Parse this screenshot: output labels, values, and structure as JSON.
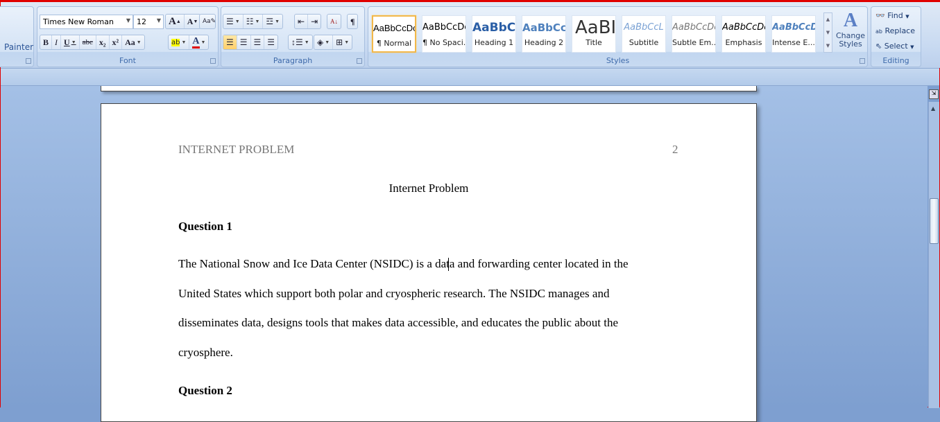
{
  "ribbon": {
    "clipboard": {
      "painter_label": "Painter"
    },
    "font": {
      "label": "Font",
      "font_name": "Times New Roman",
      "font_size": "12",
      "buttons": [
        "B",
        "I",
        "U",
        "abc",
        "x₂",
        "x²",
        "Aa"
      ],
      "font_color": "#e00000",
      "highlight_color": "#ffff00"
    },
    "paragraph": {
      "label": "Paragraph",
      "active_alignment": "align-left"
    },
    "styles": {
      "label": "Styles",
      "items": [
        {
          "preview": "AaBbCcDc",
          "name": "¶ Normal",
          "selected": true
        },
        {
          "preview": "AaBbCcDc",
          "name": "¶ No Spaci..."
        },
        {
          "preview": "AaBbC(",
          "name": "Heading 1"
        },
        {
          "preview": "AaBbCc",
          "name": "Heading 2"
        },
        {
          "preview": "AaBI",
          "name": "Title"
        },
        {
          "preview": "AaBbCcL",
          "name": "Subtitle"
        },
        {
          "preview": "AaBbCcDc",
          "name": "Subtle Em..."
        },
        {
          "preview": "AaBbCcDc",
          "name": "Emphasis"
        },
        {
          "preview": "AaBbCcDc",
          "name": "Intense E..."
        }
      ],
      "change_styles": "Change Styles"
    },
    "editing": {
      "label": "Editing",
      "find": "Find",
      "replace": "Replace",
      "select": "Select"
    }
  },
  "document": {
    "header_left": "INTERNET PROBLEM",
    "page_number": "2",
    "title": "Internet Problem",
    "q1_heading": "Question 1",
    "q1_lines": [
      "The National Snow and Ice Data Center (NSIDC) is a data and forwarding center located in the",
      "United States which support both polar and cryospheric research.  The NSIDC manages and",
      "disseminates data, designs tools that makes data accessible,  and educates the public about the",
      "cryosphere."
    ],
    "q2_heading": "Question 2"
  },
  "scrollbar": {
    "position_fraction": 0.35
  }
}
